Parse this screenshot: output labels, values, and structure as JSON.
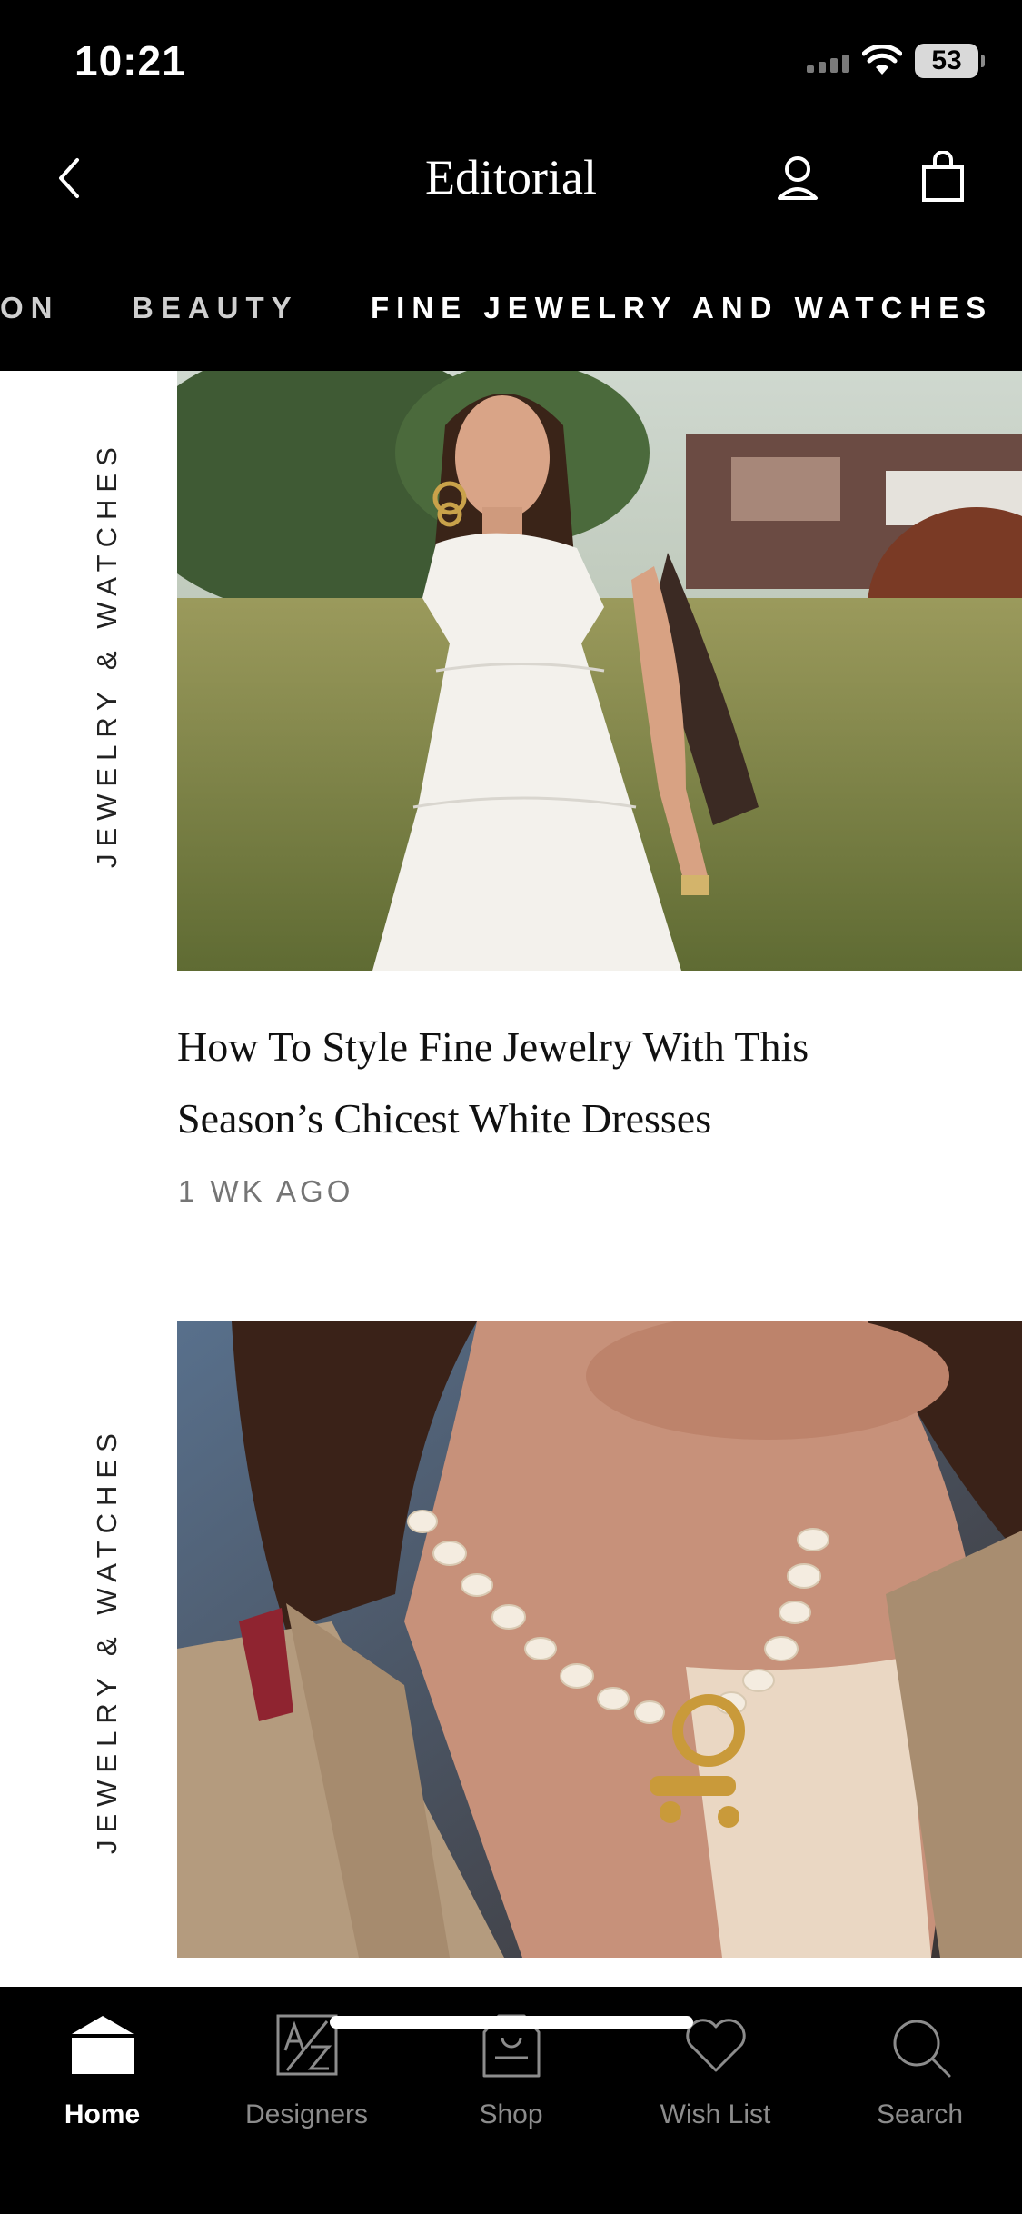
{
  "status_bar": {
    "time": "10:21",
    "battery": "53"
  },
  "header": {
    "title": "Editorial"
  },
  "category_tabs": [
    "ON",
    "BEAUTY",
    "FINE JEWELRY AND WATCHES"
  ],
  "articles": [
    {
      "category": "JEWELRY & WATCHES",
      "title_line1": "How To Style Fine Jewelry With This",
      "title_line2": "Season’s Chicest White Dresses",
      "time": "1 WK AGO"
    },
    {
      "category": "JEWELRY & WATCHES"
    }
  ],
  "tabbar": {
    "items": [
      {
        "label": "Home",
        "icon": "home-icon",
        "active": true
      },
      {
        "label": "Designers",
        "icon": "designers-az-icon",
        "active": false
      },
      {
        "label": "Shop",
        "icon": "shop-bag-icon",
        "active": false
      },
      {
        "label": "Wish List",
        "icon": "heart-icon",
        "active": false
      },
      {
        "label": "Search",
        "icon": "search-icon",
        "active": false
      }
    ]
  },
  "colors": {
    "header_bg": "#000000",
    "active_tab": "#ffffff",
    "inactive_tab": "#8c8c8c",
    "timestamp": "#757575"
  }
}
